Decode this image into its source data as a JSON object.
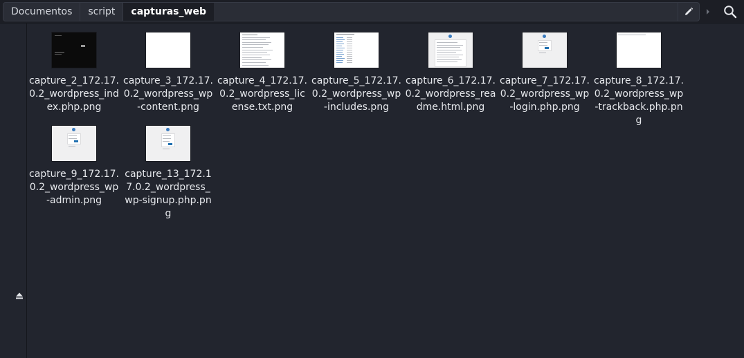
{
  "breadcrumbs": [
    {
      "label": "Documentos"
    },
    {
      "label": "script"
    },
    {
      "label": "capturas_web"
    }
  ],
  "toolbar": {
    "edit_icon": "pencil-icon",
    "arrow_icon": "chevron-right-icon",
    "search_icon": "search-icon"
  },
  "sidebar": {
    "eject_icon": "eject-icon"
  },
  "files": [
    {
      "name": "capture_2_172.17.0.2_wordpress_index.php.png",
      "thumb": "dark-page"
    },
    {
      "name": "capture_3_172.17.0.2_wordpress_wp-content.png",
      "thumb": "blank"
    },
    {
      "name": "capture_4_172.17.0.2_wordpress_license.txt.png",
      "thumb": "text-document"
    },
    {
      "name": "capture_5_172.17.0.2_wordpress_wp-includes.png",
      "thumb": "directory-listing"
    },
    {
      "name": "capture_6_172.17.0.2_wordpress_readme.html.png",
      "thumb": "readme"
    },
    {
      "name": "capture_7_172.17.0.2_wordpress_wp-login.php.png",
      "thumb": "login"
    },
    {
      "name": "capture_8_172.17.0.2_wordpress_wp-trackback.php.png",
      "thumb": "blank-line"
    },
    {
      "name": "capture_9_172.17.0.2_wordpress_wp-admin.png",
      "thumb": "login"
    },
    {
      "name": "capture_13_172.17.0.2_wordpress_wp-signup.php.png",
      "thumb": "login"
    }
  ]
}
